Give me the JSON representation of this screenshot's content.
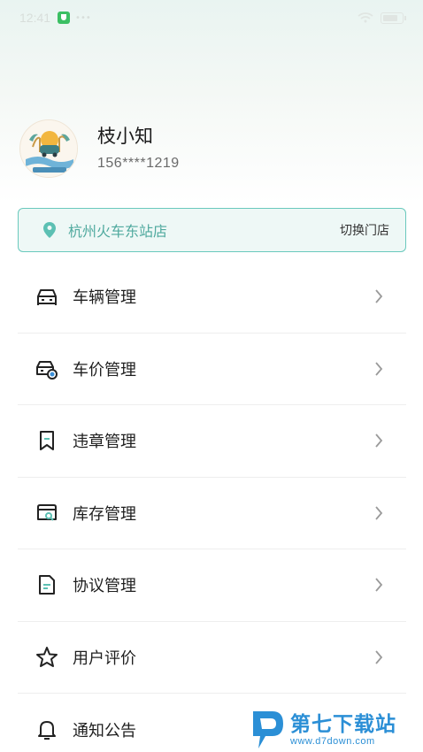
{
  "status_bar": {
    "time": "12:41",
    "dots": "•••"
  },
  "profile": {
    "name": "枝小知",
    "phone": "156****1219"
  },
  "store": {
    "name": "杭州火车东站店",
    "switch_label": "切换门店"
  },
  "menu": {
    "items": [
      {
        "label": "车辆管理",
        "icon": "car-icon"
      },
      {
        "label": "车价管理",
        "icon": "car-price-icon"
      },
      {
        "label": "违章管理",
        "icon": "bookmark-icon"
      },
      {
        "label": "库存管理",
        "icon": "inventory-icon"
      },
      {
        "label": "协议管理",
        "icon": "document-icon"
      },
      {
        "label": "用户评价",
        "icon": "star-icon"
      },
      {
        "label": "通知公告",
        "icon": "bell-icon"
      }
    ]
  },
  "watermark": {
    "title": "第七下载站",
    "url": "www.d7down.com"
  },
  "colors": {
    "accent": "#4fa99e",
    "accent_border": "#6ac9bd",
    "store_bg": "#eef8f6",
    "watermark_blue": "#2b8fd6"
  }
}
